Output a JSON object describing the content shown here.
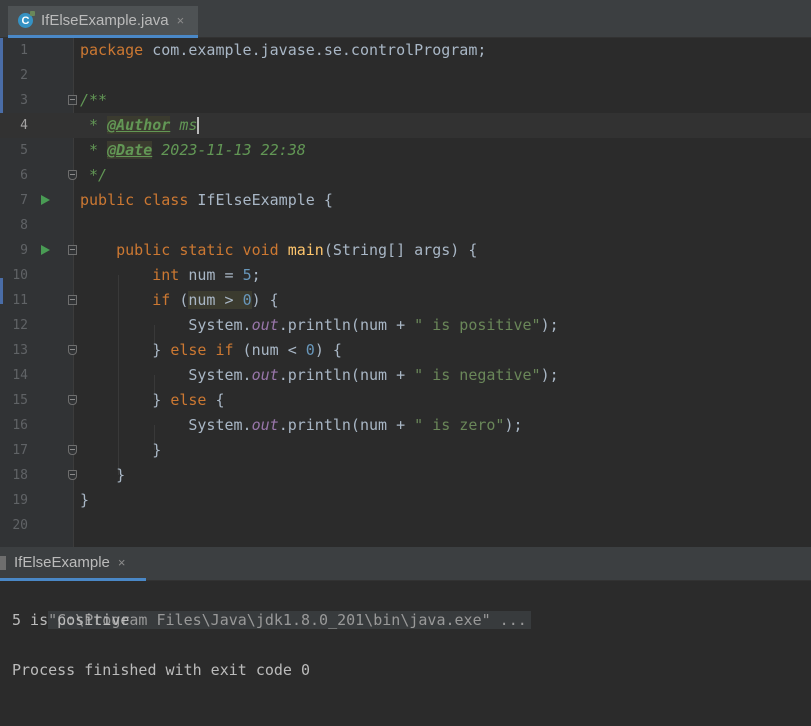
{
  "editor_tab": {
    "icon_letter": "C",
    "title": "IfElseExample.java",
    "close": "×"
  },
  "run_tab": {
    "title": "IfElseExample",
    "close": "×"
  },
  "code": {
    "line_numbers": [
      "1",
      "2",
      "3",
      "4",
      "5",
      "6",
      "7",
      "8",
      "9",
      "10",
      "11",
      "12",
      "13",
      "14",
      "15",
      "16",
      "17",
      "18",
      "19",
      "20"
    ],
    "l1": {
      "kw": "package",
      "rest": " com.example.javase.se.controlProgram;"
    },
    "l3": "/**",
    "l4": {
      "pre": " * ",
      "tag": "@Author",
      "post": " ms"
    },
    "l5": {
      "pre": " * ",
      "tag": "@Date",
      "post": " 2023-11-13 22:38"
    },
    "l6": " */",
    "l7": {
      "kw": "public class",
      "rest": " IfElseExample {"
    },
    "l9": {
      "indent": "    ",
      "kw": "public static void",
      "sp": " ",
      "fn": "main",
      "rest": "(String[] args) {"
    },
    "l10": {
      "indent": "        ",
      "kw": "int",
      "mid": " num = ",
      "num": "5",
      "end": ";"
    },
    "l11": {
      "indent": "        ",
      "kw": "if",
      "open": " (",
      "cond": "num > ",
      "num": "0",
      "end": ") {"
    },
    "l12": {
      "indent": "            ",
      "obj": "System.",
      "fld": "out",
      "call": ".println(num + ",
      "str": "\" is positive\"",
      "end": ");"
    },
    "l13": {
      "indent": "        ",
      "brace": "} ",
      "kw": "else if",
      "mid": " (num < ",
      "num": "0",
      "end": ") {"
    },
    "l14": {
      "indent": "            ",
      "obj": "System.",
      "fld": "out",
      "call": ".println(num + ",
      "str": "\" is negative\"",
      "end": ");"
    },
    "l15": {
      "indent": "        ",
      "brace": "} ",
      "kw": "else",
      "end": " {"
    },
    "l16": {
      "indent": "            ",
      "obj": "System.",
      "fld": "out",
      "call": ".println(num + ",
      "str": "\" is zero\"",
      "end": ");"
    },
    "l17": "        }",
    "l18": "    }",
    "l19": "}"
  },
  "console": {
    "command": "\"C:\\Program Files\\Java\\jdk1.8.0_201\\bin\\java.exe\" ...",
    "output": "5 is positive",
    "exit_message": "Process finished with exit code 0"
  },
  "colors": {
    "accent": "#4a88c7",
    "keyword": "#cc7832",
    "string": "#6a8759",
    "number": "#6897bb",
    "function": "#ffc66d",
    "field": "#9876aa",
    "comment": "#629755"
  }
}
